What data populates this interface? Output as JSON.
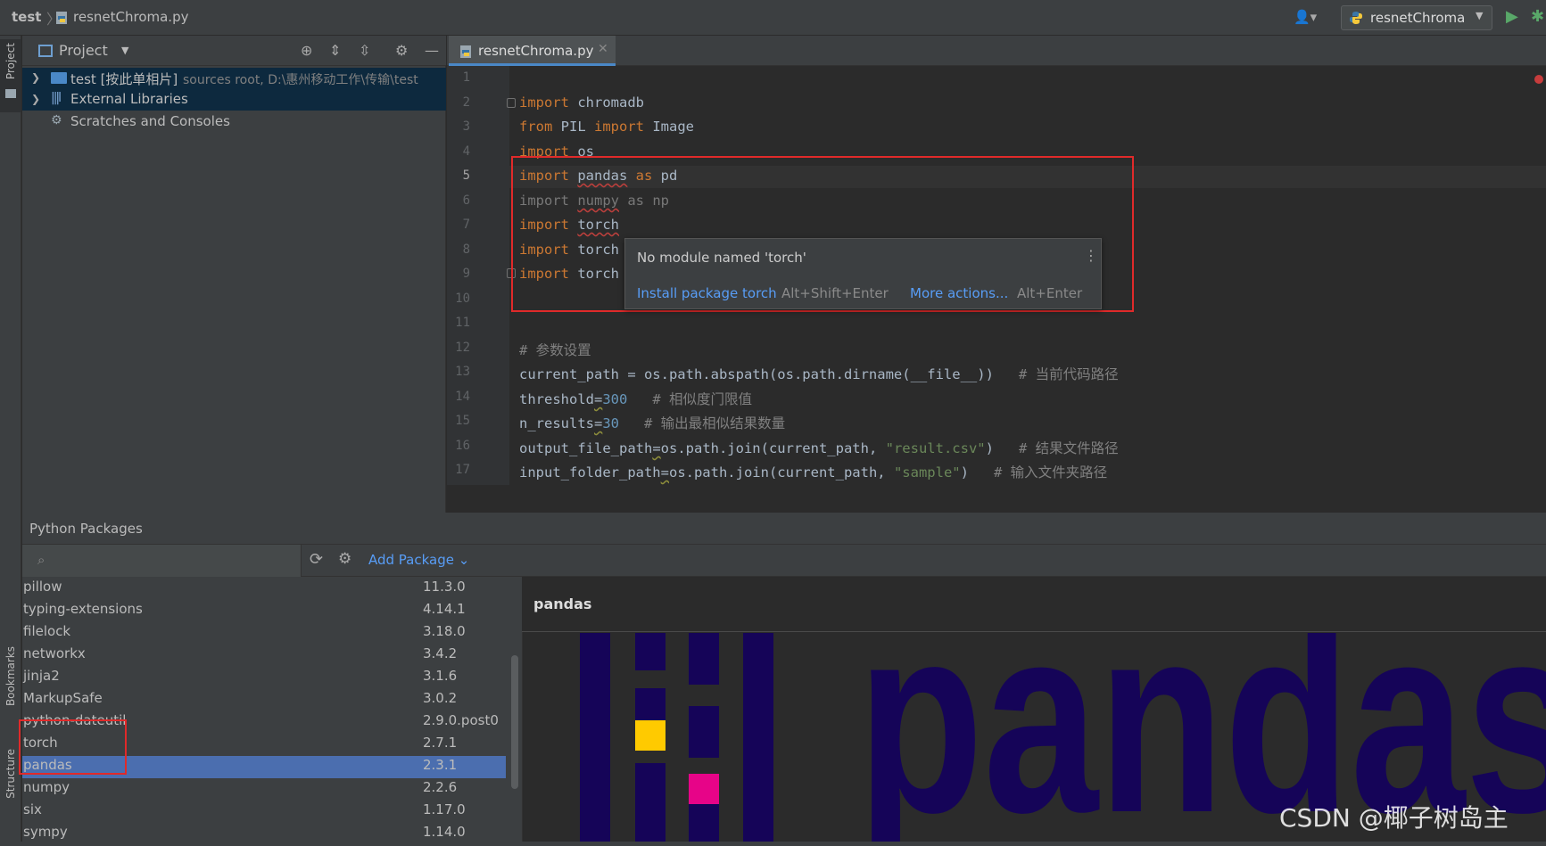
{
  "breadcrumb": {
    "project": "test",
    "separator": "〉",
    "file": "resnetChroma.py"
  },
  "run_config": {
    "label": "resnetChroma",
    "run_icon": "play-icon",
    "debug_icon": "bug-icon"
  },
  "left_stripe": {
    "project": "Project",
    "bookmarks": "Bookmarks",
    "structure": "Structure"
  },
  "project_panel": {
    "title": "Project",
    "tree": [
      {
        "label": "test [按此单相片]",
        "detail": "sources root,  D:\\惠州移动工作\\传输\\test"
      },
      {
        "label": "External Libraries"
      },
      {
        "label": "Scratches and Consoles"
      }
    ]
  },
  "editor": {
    "tab": "resnetChroma.py",
    "line_numbers": [
      "1",
      "2",
      "3",
      "4",
      "5",
      "6",
      "7",
      "8",
      "9",
      "10",
      "11",
      "12",
      "13",
      "14",
      "15",
      "16",
      "17"
    ],
    "lines": {
      "l2": {
        "kw1": "import",
        "rest": " chromadb"
      },
      "l3": {
        "kw1": "from",
        "mid": " PIL ",
        "kw2": "import",
        "rest": " Image"
      },
      "l4": {
        "kw1": "import",
        "rest": " os"
      },
      "l5": {
        "kw1": "import",
        "mod": "pandas",
        "kw2": " as",
        "rest": " pd"
      },
      "l6": {
        "text": "import ",
        "mod": "numpy",
        "rest": " as np"
      },
      "l7": {
        "kw1": "import",
        "mod": "torch"
      },
      "l8": {
        "kw1": "import",
        "mod": "torch"
      },
      "l9": {
        "kw1": "import",
        "mod": "torch"
      },
      "l12": {
        "comment": "# 参数设置"
      },
      "l13": {
        "code": "current_path = os.path.abspath(os.path.dirname(__file__))",
        "comment": "# 当前代码路径"
      },
      "l14": {
        "name": "threshold",
        "eq": "=",
        "num": "300",
        "comment": "# 相似度门限值"
      },
      "l15": {
        "name": "n_results",
        "eq": "=",
        "num": "30",
        "comment": "# 输出最相似结果数量"
      },
      "l16": {
        "name": "output_file_path",
        "eq": "=",
        "code": "os.path.join(current_path, ",
        "str": "\"result.csv\"",
        "close": ")",
        "comment": "# 结果文件路径"
      },
      "l17": {
        "name": "input_folder_path",
        "eq": "=",
        "code": "os.path.join(current_path, ",
        "str": "\"sample\"",
        "close": ")",
        "comment": "# 输入文件夹路径"
      }
    }
  },
  "tooltip": {
    "title": "No module named 'torch'",
    "more_icon": "more-vertical-icon",
    "action_1": "Install package torch",
    "shortcut_1": "Alt+Shift+Enter",
    "action_2": "More actions...",
    "shortcut_2": "Alt+Enter"
  },
  "packages": {
    "title": "Python Packages",
    "search_placeholder": "",
    "add_package": "Add Package",
    "list": [
      {
        "name": "pillow",
        "version": "11.3.0"
      },
      {
        "name": "typing-extensions",
        "version": "4.14.1"
      },
      {
        "name": "filelock",
        "version": "3.18.0"
      },
      {
        "name": "networkx",
        "version": "3.4.2"
      },
      {
        "name": "jinja2",
        "version": "3.1.6"
      },
      {
        "name": "MarkupSafe",
        "version": "3.0.2"
      },
      {
        "name": "python-dateutil",
        "version": "2.9.0.post0"
      },
      {
        "name": "torch",
        "version": "2.7.1"
      },
      {
        "name": "pandas",
        "version": "2.3.1",
        "selected": true
      },
      {
        "name": "numpy",
        "version": "2.2.6"
      },
      {
        "name": "six",
        "version": "1.17.0"
      },
      {
        "name": "sympy",
        "version": "1.14.0"
      }
    ],
    "detail_name": "pandas",
    "logo_text": "pandas"
  },
  "watermark": "CSDN @椰子树岛主",
  "colors": {
    "accent": "#4a88c7",
    "selection": "#4b6eaf",
    "highlight_box": "#e02a2a",
    "pandas_navy": "#150458",
    "pandas_yellow": "#ffca00",
    "pandas_pink": "#e70488"
  }
}
